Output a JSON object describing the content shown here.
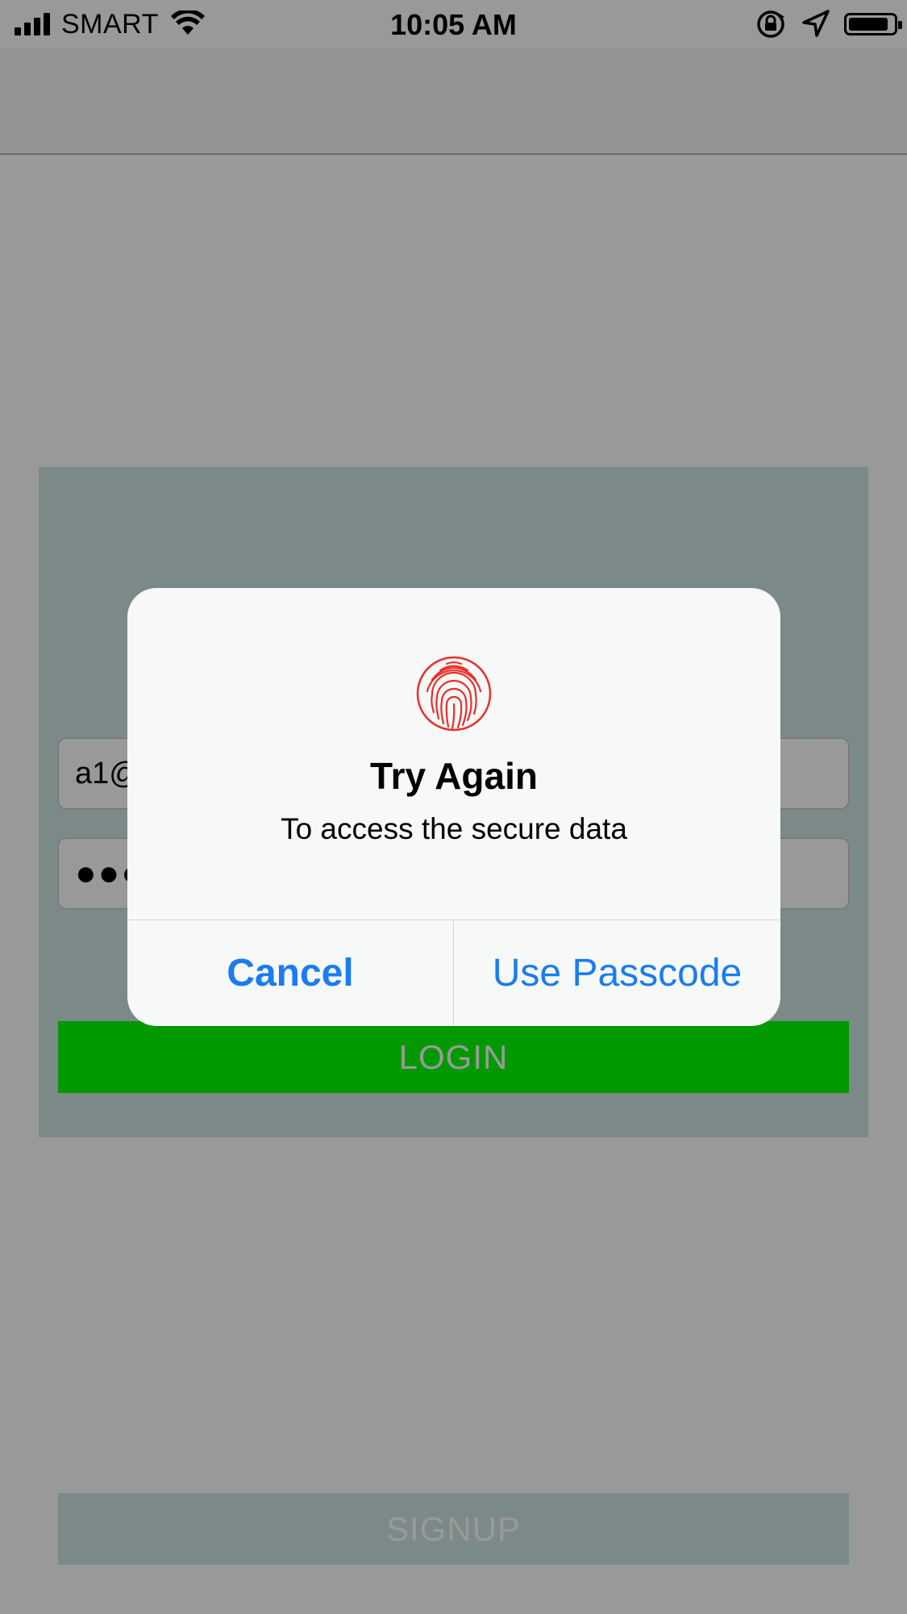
{
  "status_bar": {
    "carrier": "SMART",
    "time": "10:05 AM"
  },
  "login": {
    "email_value": "a1@",
    "password_value": "●●●",
    "login_label": "LOGIN",
    "signup_label": "SIGNUP"
  },
  "alert": {
    "icon": "fingerprint-icon",
    "title": "Try Again",
    "message": "To access the secure data",
    "cancel_label": "Cancel",
    "passcode_label": "Use Passcode"
  },
  "colors": {
    "accent_blue": "#1a7cf0",
    "login_green": "#00ff00",
    "card_teal": "#cde5e5",
    "fingerprint_red": "#e8302a"
  }
}
